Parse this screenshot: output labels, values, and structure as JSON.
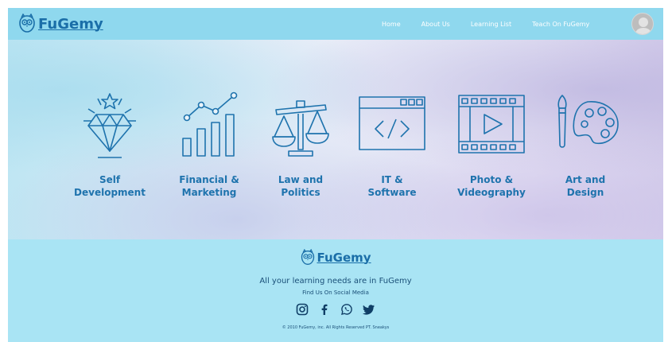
{
  "header": {
    "brand": "FuGemy",
    "nav": [
      "Home",
      "About Us",
      "Learning List",
      "Teach On FuGemy"
    ]
  },
  "categories": [
    {
      "label": "Self\nDevelopment",
      "icon": "diamond-star-icon"
    },
    {
      "label": "Financial &\nMarketing",
      "icon": "growth-chart-icon"
    },
    {
      "label": "Law and\nPolitics",
      "icon": "scales-icon"
    },
    {
      "label": "IT &\nSoftware",
      "icon": "code-window-icon"
    },
    {
      "label": "Photo &\nVideography",
      "icon": "film-play-icon"
    },
    {
      "label": "Art and\nDesign",
      "icon": "palette-brush-icon"
    }
  ],
  "footer": {
    "brand": "FuGemy",
    "tagline": "All your learning needs are in FuGemy",
    "find_us": "Find Us On Social Media",
    "socials": [
      "instagram-icon",
      "facebook-icon",
      "whatsapp-icon",
      "twitter-icon"
    ],
    "copyright": "© 2010 FuGemy, inc. All Rights Reserved PT. Sneakys"
  },
  "colors": {
    "header_bg": "#8fd8ee",
    "footer_bg": "#a9e4f4",
    "brand_blue": "#1a6ea8"
  }
}
